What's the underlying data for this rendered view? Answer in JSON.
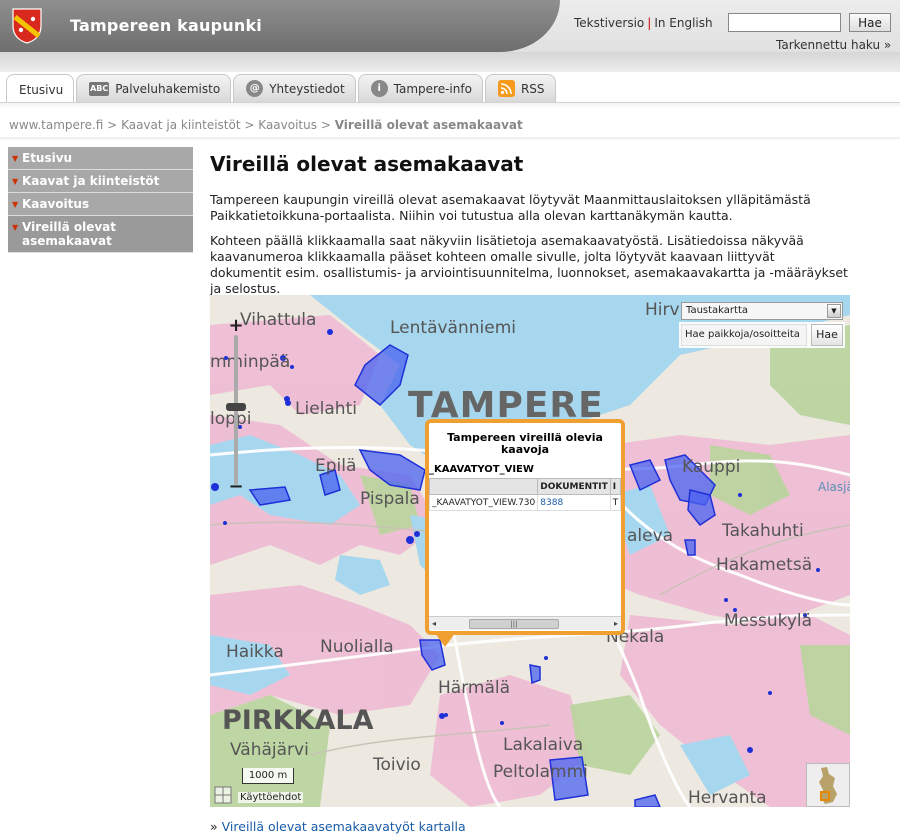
{
  "header": {
    "site_title": "Tampereen kaupunki",
    "text_version": "Tekstiversio",
    "separator": "|",
    "in_english": "In English",
    "search_placeholder": "",
    "search_button": "Hae",
    "advanced_search": "Tarkennettu haku »"
  },
  "tabs": [
    {
      "label": "Etusivu",
      "icon": "",
      "active": true
    },
    {
      "label": "Palveluhakemisto",
      "icon": "ABC",
      "active": false
    },
    {
      "label": "Yhteystiedot",
      "icon": "@",
      "active": false
    },
    {
      "label": "Tampere-info",
      "icon": "i",
      "active": false
    },
    {
      "label": "RSS",
      "icon": "rss",
      "active": false
    }
  ],
  "breadcrumb": {
    "items": [
      "www.tampere.fi",
      "Kaavat ja kiinteistöt",
      "Kaavoitus"
    ],
    "separator": ">",
    "current": "Vireillä olevat asemakaavat"
  },
  "leftnav": {
    "items": [
      {
        "label": "Etusivu"
      },
      {
        "label": "Kaavat ja kiinteistöt"
      },
      {
        "label": "Kaavoitus"
      },
      {
        "label": "Vireillä olevat asemakaavat"
      }
    ]
  },
  "main": {
    "title": "Vireillä olevat asemakaavat",
    "para1": "Tampereen kaupungin vireillä olevat asemakaavat löytyvät Maanmittauslaitoksen ylläpitämästä Paikkatietoikkuna-portaalista. Niihin voi tutustua alla olevan karttanäkymän kautta.",
    "para2": "Kohteen päällä klikkaamalla saat näkyviin lisätietoja asemakaavatyöstä. Lisätiedoissa näkyvää kaavanumeroa klikkaamalla pääset kohteen omalle sivulle, jolta löytyvät kaavaan liittyvät dokumentit esim. osallistumis- ja arviointisuunnitelma, luonnokset, asemakaavakartta ja -määräykset ja selostus."
  },
  "map": {
    "zoom_in": "+",
    "zoom_out": "−",
    "layer_select": "Taustakartta",
    "place_search_placeholder": "Hae paikkoja/osoitteita",
    "place_search_button": "Hae",
    "labels": {
      "tampere": "TAMPERE",
      "pirkkala": "PIRKKALA",
      "lentavanniemi": "Lentävänniemi",
      "vihattula": "Vihattula",
      "hirv": "Hirv",
      "lielahti": "Lielahti",
      "epila": "Epilä",
      "pispala": "Pispala",
      "kauppi": "Kauppi",
      "takahuhti": "Takahuhti",
      "hakametsa": "Hakametsä",
      "messukyla": "Messukylä",
      "kaleva": "aleva",
      "nekala": "Nekala",
      "haikka": "Haikka",
      "nuolialla": "Nuolialla",
      "harmala": "Härmälä",
      "vahajarvi": "Vähäjärvi",
      "toivio": "Toivio",
      "lakalaiva": "Lakalaiva",
      "peltolammi": "Peltolammi",
      "hervanta": "Hervanta",
      "mannpaa": "mminpää",
      "loppi": "loppi",
      "alasja": "Alasjä"
    },
    "popup": {
      "title": "Tampereen vireillä olevia kaavoja",
      "layer_name": "_KAAVATYOT_VIEW",
      "col_document": "DOKUMENTIT",
      "col_extra": "I",
      "row_id": "_KAAVATYOT_VIEW.730",
      "row_doc": "8388",
      "row_extra": "T",
      "scroll_left": "◂",
      "scroll_thumb": "|||",
      "scroll_right": "▸"
    },
    "scale": "1000 m",
    "terms": "Käyttöehdot"
  },
  "bottom_link": {
    "prefix": "»",
    "label": "Vireillä olevat asemakaavatyöt kartalla"
  }
}
